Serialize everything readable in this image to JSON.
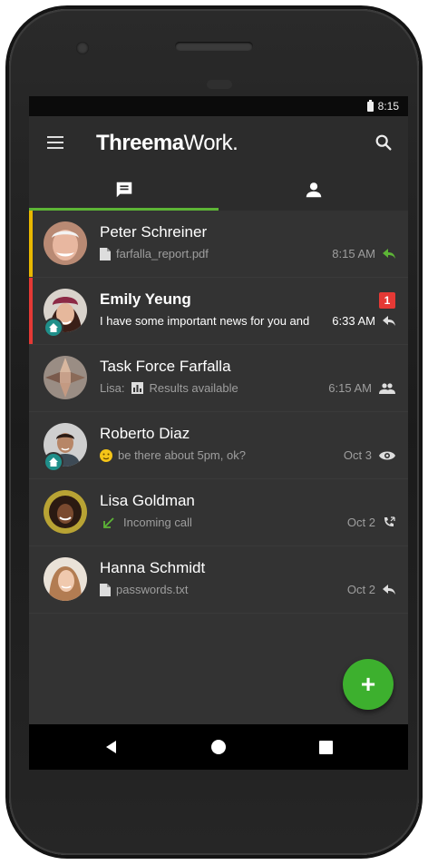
{
  "status_bar": {
    "time": "8:15"
  },
  "app_bar": {
    "title_bold": "Threema",
    "title_light": "Work."
  },
  "colors": {
    "accent": "#5db536",
    "fab": "#3db02e",
    "unread_stripe": "#e53935",
    "pinned_stripe": "#e8b800",
    "work_badge": "#1f8f8a",
    "unread_badge": "#e53935"
  },
  "tabs": [
    {
      "icon": "chat-icon",
      "selected": true
    },
    {
      "icon": "contact-icon",
      "selected": false
    }
  ],
  "conversations": [
    {
      "name": "Peter Schreiner",
      "preview": "farfalla_report.pdf",
      "preview_icon": "file-icon",
      "time": "8:15 AM",
      "status_icon": "reply-arrow-icon",
      "status_color": "#5db536",
      "stripe": "pinned"
    },
    {
      "name": "Emily Yeung",
      "preview": "I have some important news for you and",
      "time": "6:33 AM",
      "status_icon": "reply-arrow-icon",
      "unread_count": "1",
      "stripe": "unread",
      "work_badge": true
    },
    {
      "name": "Task Force Farfalla",
      "preview_sender": "Lisa:",
      "preview": "Results available",
      "preview_icon": "poll-icon",
      "time": "6:15 AM",
      "status_icon": "group-icon"
    },
    {
      "name": "Roberto Diaz",
      "preview": "be there about 5pm, ok?",
      "preview_icon": "emoji-icon",
      "time": "Oct 3",
      "status_icon": "eye-icon",
      "work_badge": true
    },
    {
      "name": "Lisa Goldman",
      "preview": "Incoming call",
      "preview_icon": "incoming-call-arrow-icon",
      "time": "Oct 2",
      "status_icon": "phone-icon"
    },
    {
      "name": "Hanna Schmidt",
      "preview": "passwords.txt",
      "preview_icon": "file-icon",
      "time": "Oct 2",
      "status_icon": "reply-arrow-icon"
    }
  ],
  "fab": {
    "label": "+"
  }
}
